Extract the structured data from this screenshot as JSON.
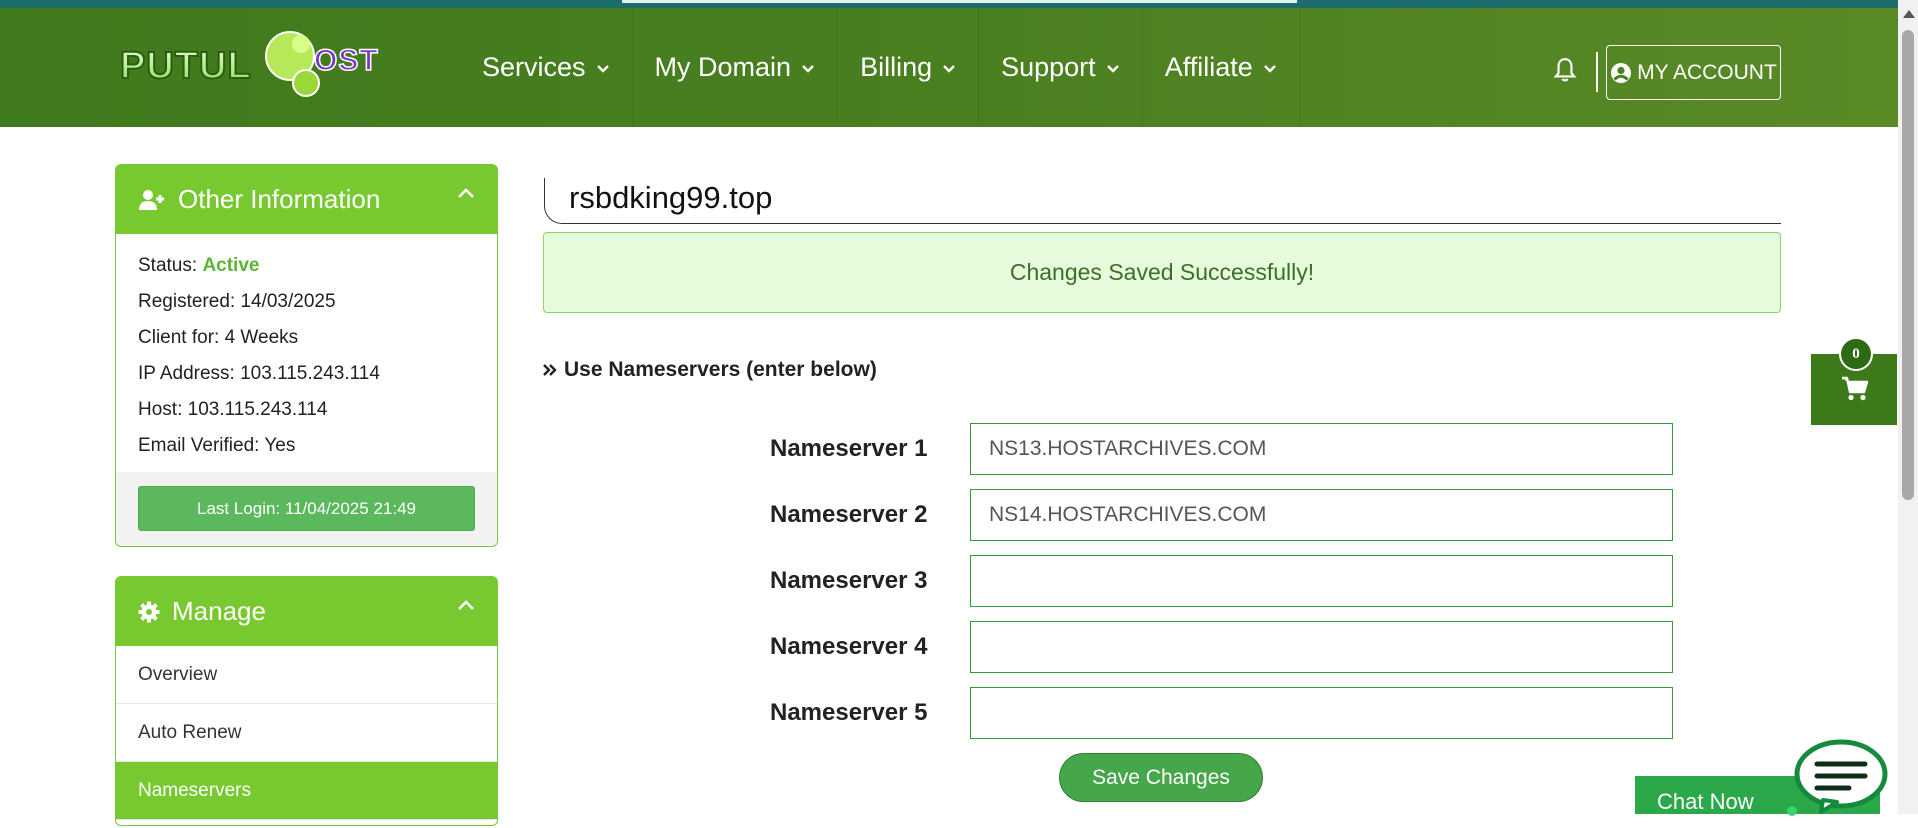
{
  "header": {
    "logo_text": "PUTULHOST",
    "nav": [
      {
        "label": "Services"
      },
      {
        "label": "My Domain"
      },
      {
        "label": "Billing"
      },
      {
        "label": "Support"
      },
      {
        "label": "Affiliate"
      }
    ],
    "account_label": "MY ACCOUNT"
  },
  "sidebar": {
    "info": {
      "title": "Other Information",
      "status_label": "Status:",
      "status_value": "Active",
      "registered": "Registered: 14/03/2025",
      "client_for": "Client for: 4 Weeks",
      "ip": "IP Address: 103.115.243.114",
      "host": "Host: 103.115.243.114",
      "email_verified": "Email Verified: Yes",
      "last_login": "Last Login: 11/04/2025 21:49"
    },
    "manage": {
      "title": "Manage",
      "items": [
        {
          "label": "Overview"
        },
        {
          "label": "Auto Renew"
        },
        {
          "label": "Nameservers"
        }
      ]
    }
  },
  "main": {
    "domain": "rsbdking99.top",
    "alert": "Changes Saved Successfully!",
    "option_label": "Use Nameservers (enter below)",
    "nameservers": [
      {
        "label": "Nameserver 1",
        "value": "NS13.HOSTARCHIVES.COM"
      },
      {
        "label": "Nameserver 2",
        "value": "NS14.HOSTARCHIVES.COM"
      },
      {
        "label": "Nameserver 3",
        "value": ""
      },
      {
        "label": "Nameserver 4",
        "value": ""
      },
      {
        "label": "Nameserver 5",
        "value": ""
      }
    ],
    "save_label": "Save Changes"
  },
  "cart": {
    "count": "0"
  },
  "chat": {
    "label": "Chat Now"
  },
  "colors": {
    "header": "#4a7f20",
    "accent": "#77c92f",
    "success": "#5cb85c"
  }
}
